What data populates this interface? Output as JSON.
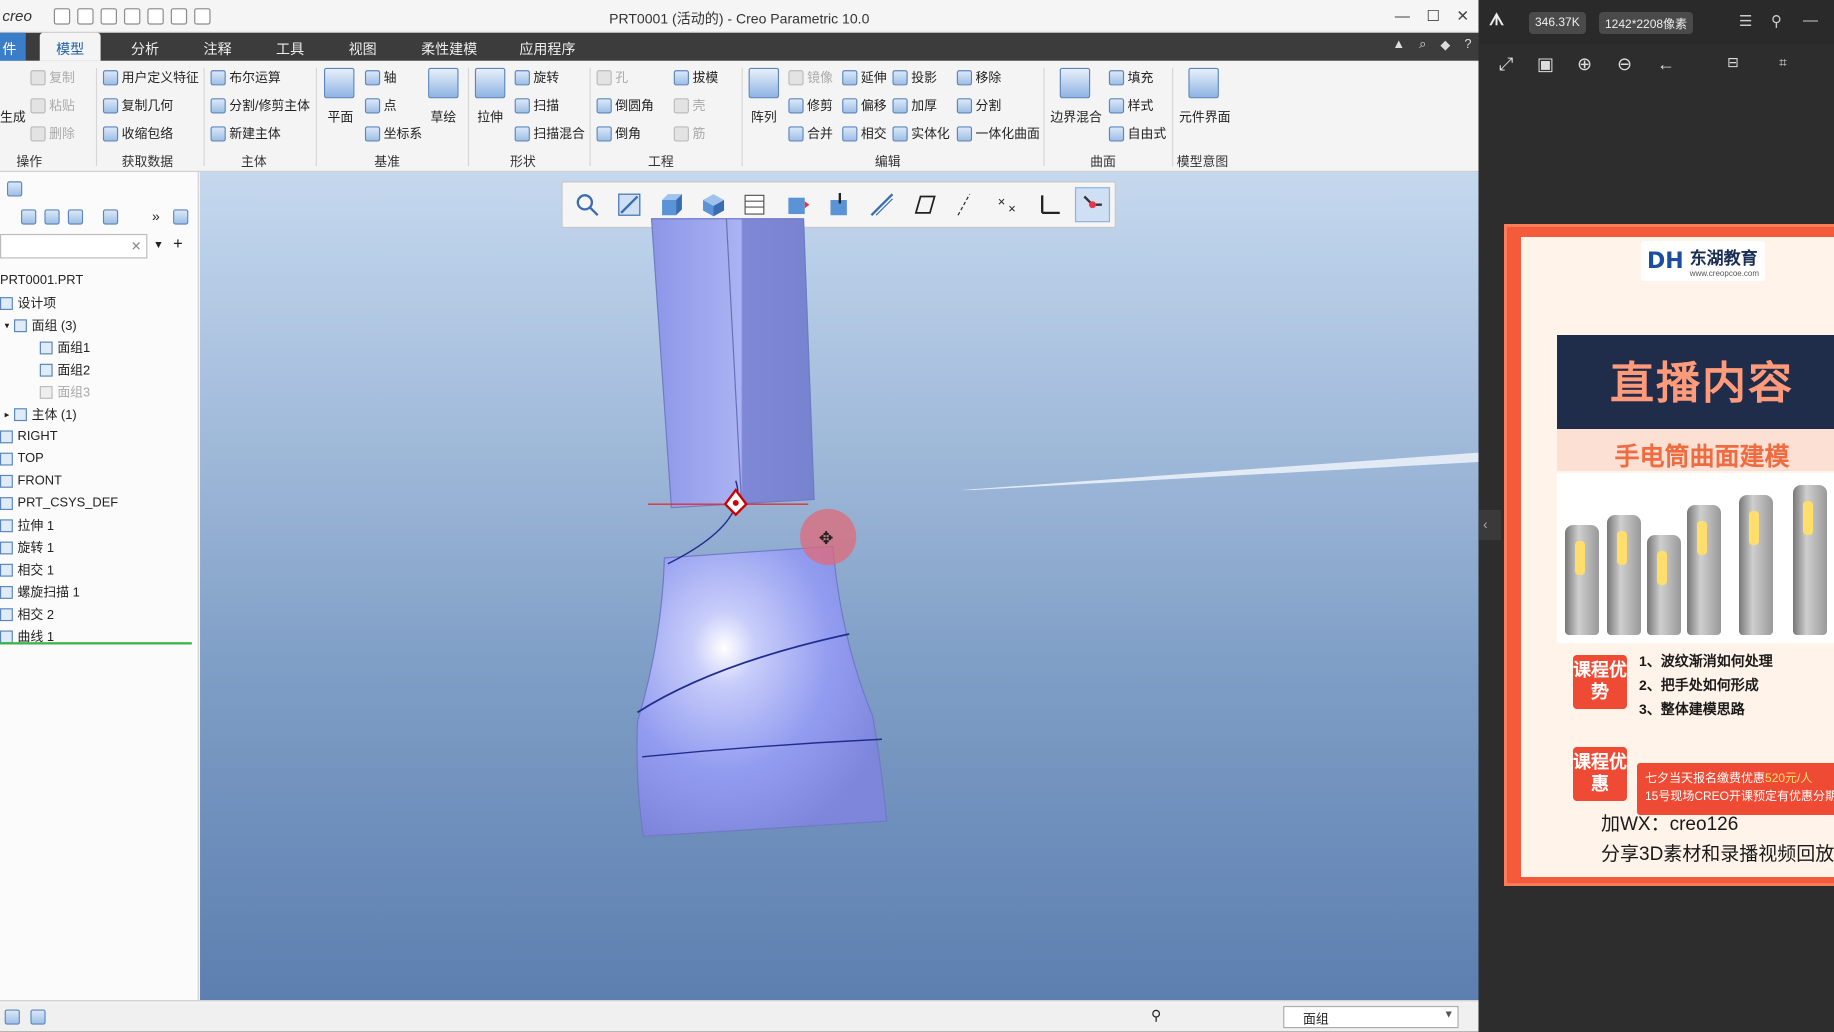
{
  "app": {
    "logo": "creo",
    "window_title": "PRT0001 (活动的) - Creo Parametric 10.0",
    "window_controls": [
      "—",
      "☐",
      "✕"
    ]
  },
  "tabs": [
    {
      "label": "件"
    },
    {
      "label": "模型"
    },
    {
      "label": "分析"
    },
    {
      "label": "注释"
    },
    {
      "label": "工具"
    },
    {
      "label": "视图"
    },
    {
      "label": "柔性建模"
    },
    {
      "label": "应用程序"
    }
  ],
  "ribbon": {
    "operations": {
      "regen": "生成",
      "copy": "复制",
      "paste": "粘贴",
      "delete": "删除",
      "group": "操作"
    },
    "get_data": {
      "udf": "用户定义特征",
      "copy_geom": "复制几何",
      "shrinkwrap": "收缩包络",
      "group": "获取数据"
    },
    "body": {
      "boolean": "布尔运算",
      "split": "分割/修剪主体",
      "new_body": "新建主体",
      "group": "主体"
    },
    "datum": {
      "plane": "平面",
      "axis": "轴",
      "point": "点",
      "csys": "坐标系",
      "sketch": "草绘",
      "group": "基准"
    },
    "shapes": {
      "extrude": "拉伸",
      "revolve": "旋转",
      "sweep": "扫描",
      "swept_blend": "扫描混合",
      "group": "形状"
    },
    "engineering": {
      "hole": "孔",
      "round": "倒圆角",
      "chamfer": "倒角",
      "draft": "拔模",
      "shell": "壳",
      "rib": "筋",
      "group": "工程"
    },
    "editing": {
      "pattern": "阵列",
      "mirror": "镜像",
      "trim": "修剪",
      "merge": "合并",
      "extend": "延伸",
      "offset": "偏移",
      "intersect": "相交",
      "project": "投影",
      "thicken": "加厚",
      "solidify": "实体化",
      "remove": "移除",
      "split": "分割",
      "unify": "一体化曲面",
      "group": "编辑"
    },
    "surfaces": {
      "boundary_blend": "边界混合",
      "fill": "填充",
      "style": "样式",
      "freestyle": "自由式",
      "group": "曲面"
    },
    "model_intent": {
      "component_interface": "元件界面",
      "group": "模型意图"
    }
  },
  "model_tree": {
    "filter_clear": "✕",
    "items": [
      {
        "label": "PRT0001.PRT"
      },
      {
        "label": "设计项"
      },
      {
        "label": "面组 (3)"
      },
      {
        "label": "面组1"
      },
      {
        "label": "面组2"
      },
      {
        "label": "面组3"
      },
      {
        "label": "主体 (1)"
      },
      {
        "label": "RIGHT"
      },
      {
        "label": "TOP"
      },
      {
        "label": "FRONT"
      },
      {
        "label": "PRT_CSYS_DEF"
      },
      {
        "label": "拉伸 1"
      },
      {
        "label": "旋转 1"
      },
      {
        "label": "相交 1"
      },
      {
        "label": "螺旋扫描 1"
      },
      {
        "label": "相交 2"
      },
      {
        "label": "曲线 1"
      }
    ]
  },
  "status_bar": {
    "selection_filter": "面组"
  },
  "viewer": {
    "file_size": "346.37K",
    "dimensions": "1242*2208像素",
    "poster": {
      "brand": "东湖教育",
      "brand_url": "www.creopcoe.com",
      "headline": "直播内容",
      "subtitle": "手电筒曲面建模",
      "badge1": "课程优势",
      "points": [
        "1、波纹渐消如何处理",
        "2、把手处如何形成",
        "3、整体建模思路"
      ],
      "badge2": "课程优惠",
      "promo_line1_a": "七夕当天报名缴费优惠",
      "promo_line1_b": "520元/人",
      "promo_line2": "15号现场CREO开课预定有优惠分期",
      "wx": "加WX：creo126",
      "share": "分享3D素材和录播视频回放"
    }
  },
  "colors": {
    "accent": "#3a7ec9",
    "ribbon_dark": "#3c3c3c",
    "poster_red": "#ef4b34",
    "poster_navy": "#1f2c4a"
  }
}
